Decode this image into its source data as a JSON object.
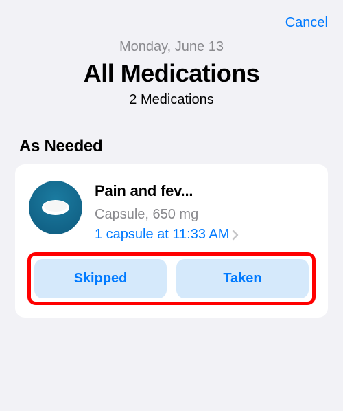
{
  "nav": {
    "cancel": "Cancel"
  },
  "header": {
    "date": "Monday, June 13",
    "title": "All Medications",
    "subtitle": "2 Medications"
  },
  "section": {
    "label": "As Needed"
  },
  "medication": {
    "name": "Pain and fev...",
    "detail": "Capsule, 650 mg",
    "log": "1 capsule at 11:33 AM"
  },
  "actions": {
    "skipped": "Skipped",
    "taken": "Taken"
  }
}
